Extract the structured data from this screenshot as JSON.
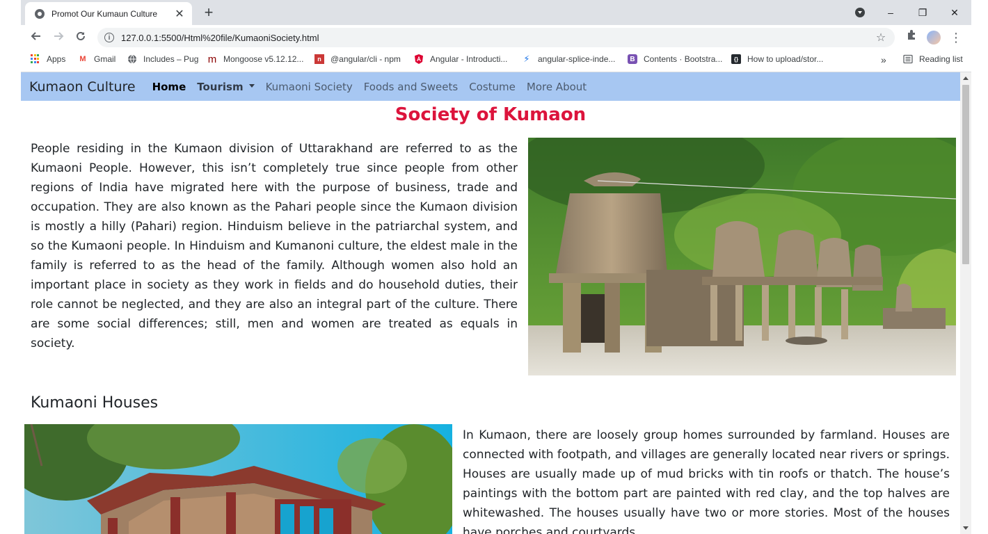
{
  "browser": {
    "tab_title": "Promot Our Kumaun Culture",
    "tab_close_glyph": "✕",
    "new_tab_glyph": "+",
    "url": "127.0.0.1:5500/Html%20file/KumaoniSociety.html",
    "window_controls": {
      "minimize": "–",
      "maximize": "❐",
      "close": "✕"
    },
    "bookmarks": [
      {
        "label": "Apps",
        "icon": "apps-grid-icon"
      },
      {
        "label": "Gmail",
        "icon": "gmail-icon"
      },
      {
        "label": "Includes – Pug",
        "icon": "globe-icon"
      },
      {
        "label": "Mongoose v5.12.12...",
        "icon": "mongoose-icon"
      },
      {
        "label": "@angular/cli - npm",
        "icon": "npm-icon"
      },
      {
        "label": "Angular - Introducti...",
        "icon": "angular-icon"
      },
      {
        "label": "angular-splice-inde...",
        "icon": "bolt-icon"
      },
      {
        "label": "Contents · Bootstra...",
        "icon": "bootstrap-icon"
      },
      {
        "label": "How to upload/stor...",
        "icon": "code-icon"
      }
    ],
    "overflow_glyph": "»",
    "reading_list": "Reading list",
    "colors": {
      "tabstrip": "#dee1e6",
      "omnibox": "#f1f3f4"
    }
  },
  "site": {
    "brand": "Kumaon Culture",
    "nav": [
      {
        "label": "Home",
        "state": "active"
      },
      {
        "label": "Tourism",
        "state": "dropdown"
      },
      {
        "label": "Kumaoni Society",
        "state": "default"
      },
      {
        "label": "Foods and Sweets",
        "state": "default"
      },
      {
        "label": "Costume",
        "state": "default"
      },
      {
        "label": "More About",
        "state": "default"
      }
    ],
    "colors": {
      "navbar": "#a7c7f2",
      "title": "#dc143c"
    }
  },
  "main": {
    "title": "Society of Kumaon",
    "intro": "People residing in the Kumaon division of Uttarakhand are referred to as the Kumaoni People. However, this isn’t completely true since people from other regions of India have migrated here with the purpose of business, trade and occupation. They are also known as the Pahari people since the Kumaon division is mostly a hilly (Pahari) region. Hinduism believe in the patriarchal system, and so the Kumaoni people. In Hinduism and Kumanoni culture, the eldest male in the family is referred to as the head of the family. Although women also hold an important place in society as they work in fields and do household duties, their role cannot be neglected, and they are also an integral part of the culture. There are some social differences; still, men and women are treated as equals in society.",
    "houses_heading": "Kumaoni Houses",
    "houses_text": "In Kumaon, there are loosely group homes surrounded by farmland. Houses are connected with footpath, and villages are generally located near rivers or springs. Houses are usually made up of mud bricks with tin roofs or thatch. The house’s paintings with the bottom part are painted with red clay, and the top halves are whitewashed. The houses usually have two or more stories. Most of the houses have porches and courtyards."
  }
}
